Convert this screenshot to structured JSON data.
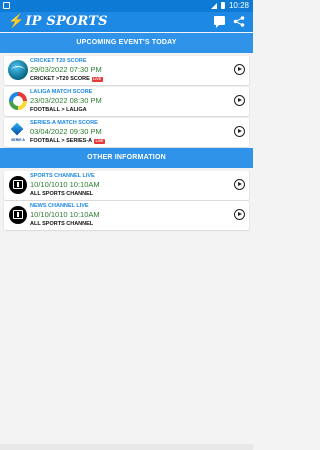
{
  "status_bar": {
    "time": "10:28"
  },
  "app_bar": {
    "title": "IP SPORTS",
    "icons": [
      "chat-icon",
      "share-icon"
    ]
  },
  "sections": {
    "upcoming": "UPCOMING EVENT'S TODAY",
    "other": "OTHER INFORMATION"
  },
  "events": [
    {
      "title": "CRICKET T20 SCORE",
      "datetime": "29/03/2022 07:30 PM",
      "category": "CRICKET >T20 SCORE",
      "badge": "LIVE",
      "icon": "cricket-ball-icon"
    },
    {
      "title": "LALIGA MATCH SCORE",
      "datetime": "23/03/2022 08:30 PM",
      "category": "FOOTBALL > LALIGA",
      "badge": "",
      "icon": "laliga-icon"
    },
    {
      "title": "SERIES-A MATCH SCORE",
      "datetime": "03/04/2022 09:30 PM",
      "category": "FOOTBALL > SERIES-A",
      "badge": "LIVE",
      "icon": "seriea-icon",
      "logo_text": "SERIE A"
    }
  ],
  "channels": [
    {
      "title": "SPORTS CHANNEL LIVE",
      "datetime": "10/10/1010 10:10AM",
      "category": "ALL SPORTS CHANNEL",
      "icon": "tv-icon"
    },
    {
      "title": "NEWS CHANNEL LIVE",
      "datetime": "10/10/1010 10:10AM",
      "category": "ALL SPORTS CHANNEL",
      "icon": "tv-icon"
    }
  ],
  "colors": {
    "primary": "#1e88e5",
    "header": "#2f93ea",
    "date_green": "#2e7d32",
    "live_red": "#e53935"
  }
}
